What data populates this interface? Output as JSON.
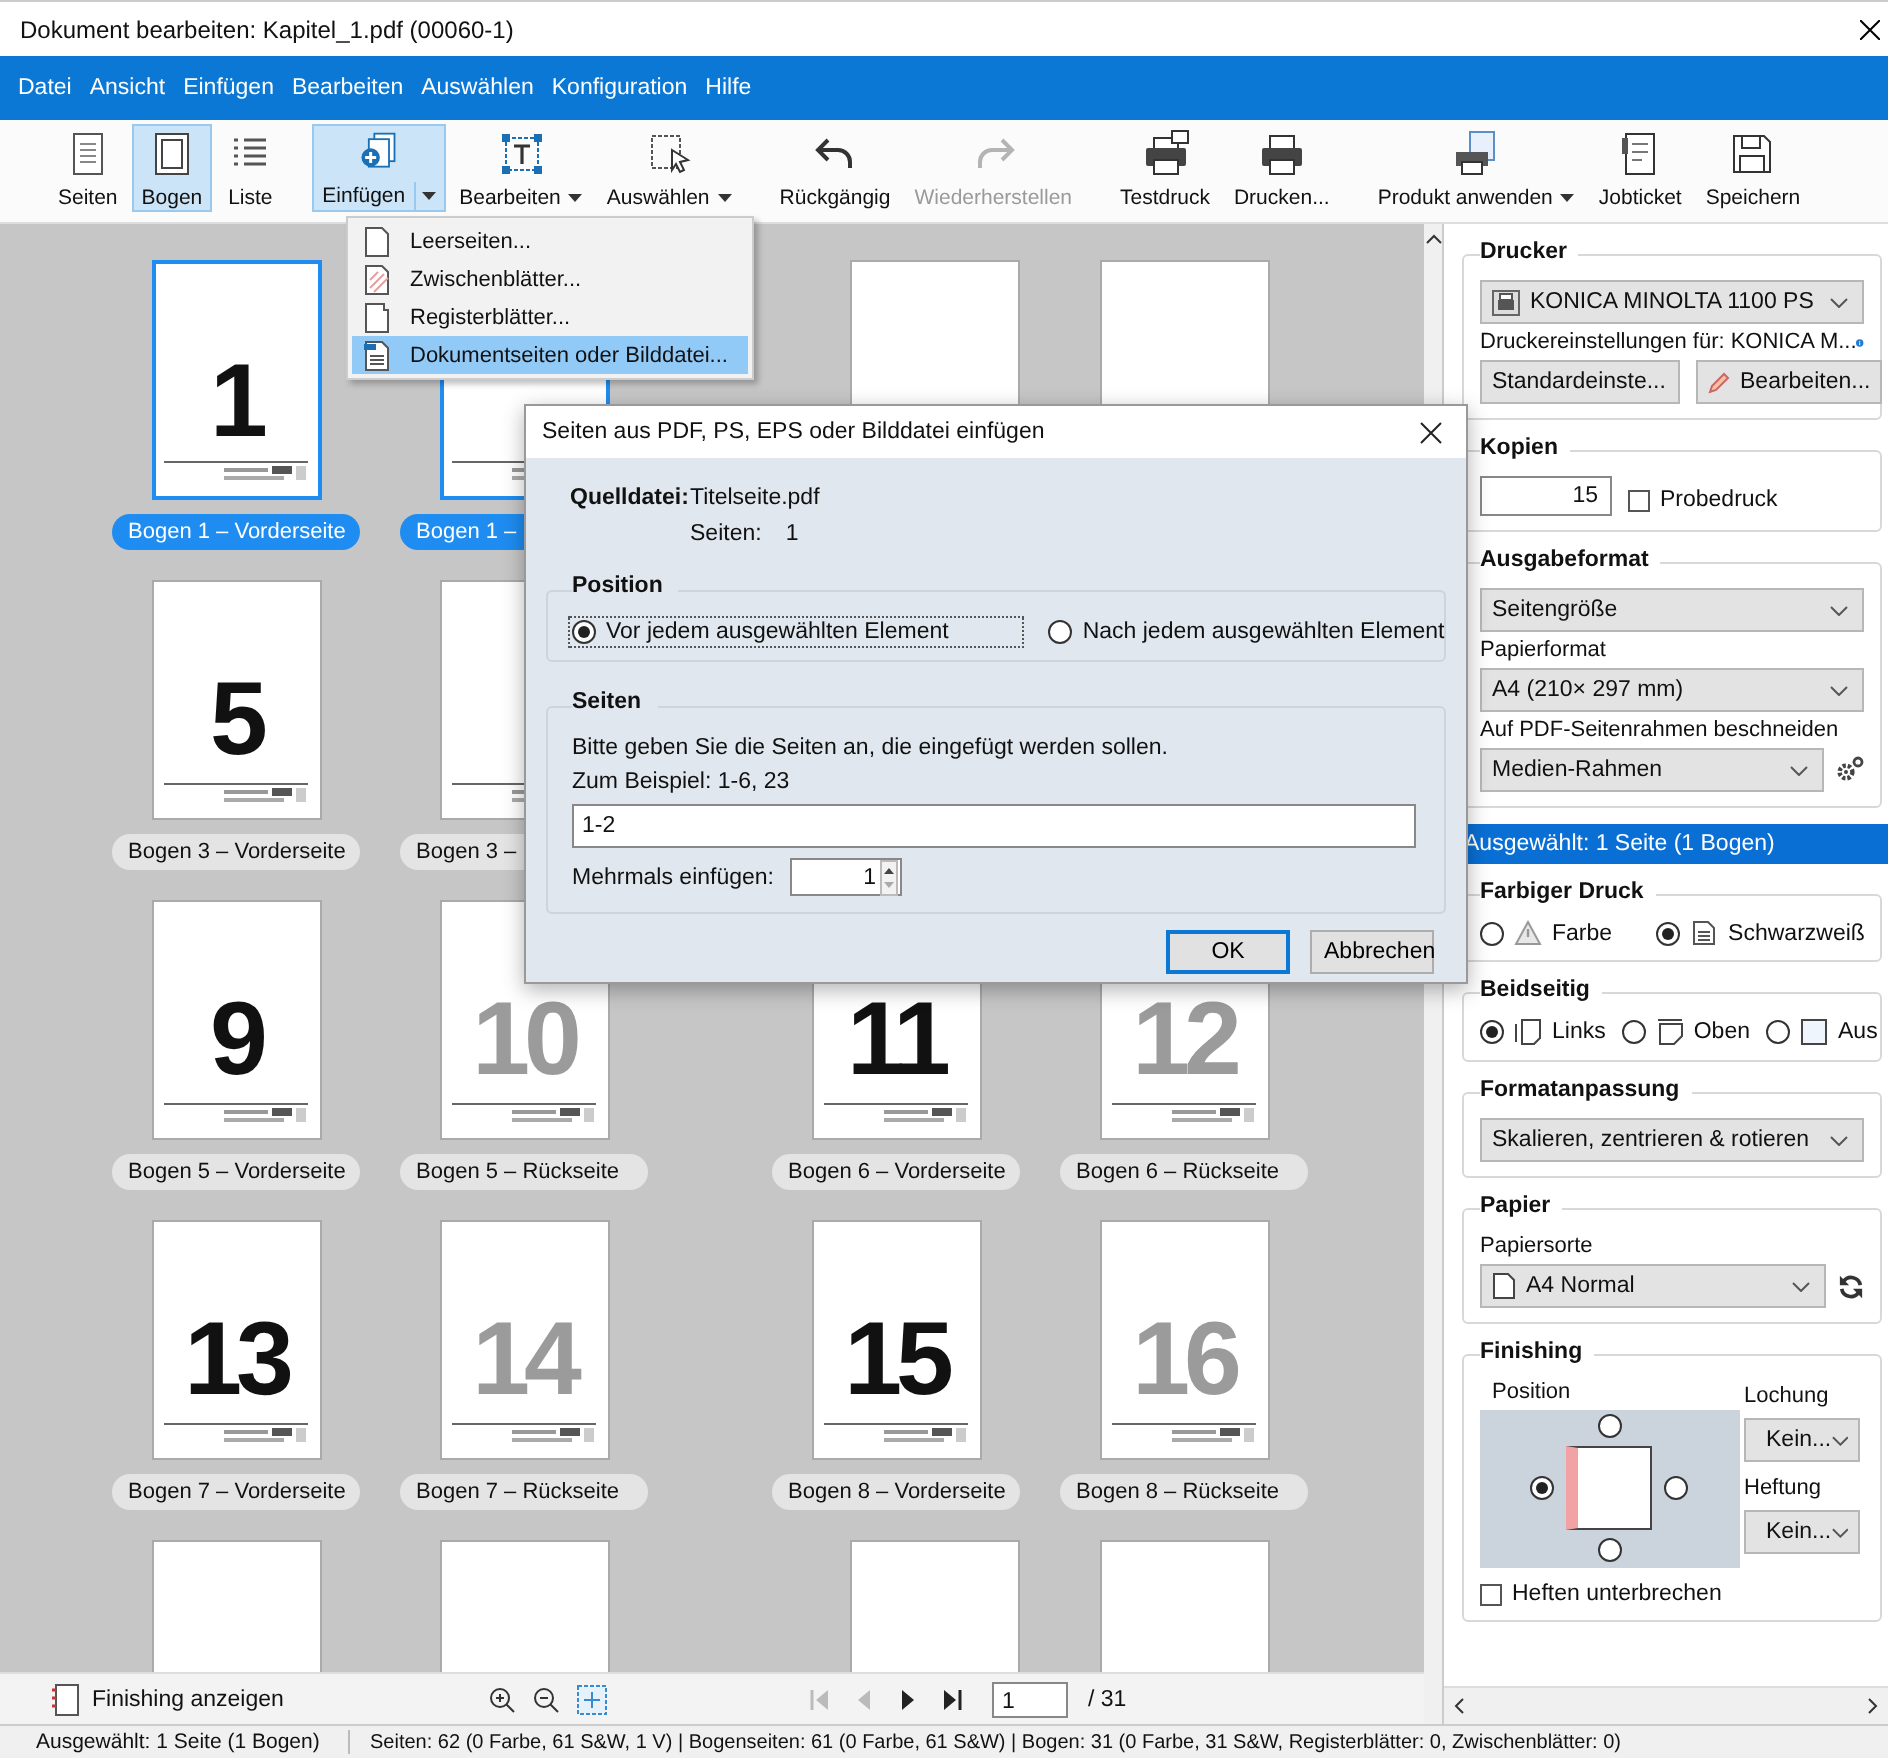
{
  "window": {
    "title": "Dokument bearbeiten: Kapitel_1.pdf (00060-1)"
  },
  "menu": [
    "Datei",
    "Ansicht",
    "Einfügen",
    "Bearbeiten",
    "Auswählen",
    "Konfiguration",
    "Hilfe"
  ],
  "toolbar": {
    "groups": [
      {
        "items": [
          {
            "label": "Seiten",
            "selected": false,
            "expanded": false,
            "disabled": false,
            "dropdown": false
          },
          {
            "label": "Bogen",
            "selected": true,
            "expanded": false,
            "disabled": false,
            "dropdown": false
          },
          {
            "label": "Liste",
            "selected": false,
            "expanded": false,
            "disabled": false,
            "dropdown": false
          }
        ]
      },
      {
        "items": [
          {
            "label": "Einfügen",
            "selected": false,
            "expanded": true,
            "disabled": false,
            "dropdown": true
          },
          {
            "label": "Bearbeiten",
            "selected": false,
            "expanded": false,
            "disabled": false,
            "dropdown": true
          },
          {
            "label": "Auswählen",
            "selected": false,
            "expanded": false,
            "disabled": false,
            "dropdown": true
          }
        ]
      },
      {
        "items": [
          {
            "label": "Rückgängig",
            "selected": false,
            "expanded": false,
            "disabled": false,
            "dropdown": false
          },
          {
            "label": "Wiederherstellen",
            "selected": false,
            "expanded": false,
            "disabled": true,
            "dropdown": false
          }
        ]
      },
      {
        "items": [
          {
            "label": "Testdruck",
            "selected": false,
            "expanded": false,
            "disabled": false,
            "dropdown": false
          },
          {
            "label": "Drucken...",
            "selected": false,
            "expanded": false,
            "disabled": false,
            "dropdown": false
          }
        ]
      },
      {
        "items": [
          {
            "label": "Produkt anwenden",
            "selected": false,
            "expanded": false,
            "disabled": false,
            "dropdown": true
          },
          {
            "label": "Jobticket",
            "selected": false,
            "expanded": false,
            "disabled": false,
            "dropdown": false
          },
          {
            "label": "Speichern",
            "selected": false,
            "expanded": false,
            "disabled": false,
            "dropdown": false
          }
        ]
      }
    ]
  },
  "insert_menu": [
    {
      "label": "Leerseiten...",
      "selected": false
    },
    {
      "label": "Zwischenblätter...",
      "selected": false
    },
    {
      "label": "Registerblätter...",
      "selected": false
    },
    {
      "label": "Dokumentseiten oder Bilddatei...",
      "selected": true
    }
  ],
  "thumbnails": {
    "rows": [
      [
        {
          "number": "1",
          "label": "Bogen 1 – Vorderseite",
          "kind": "front",
          "selected": true
        },
        {
          "label": "Bogen 1 –",
          "selected": true
        },
        {
          "selected": false
        },
        {
          "selected": false
        }
      ],
      [
        {
          "number": "5",
          "label": "Bogen 3 – Vorderseite",
          "kind": "front",
          "selected": false
        },
        {
          "label": "Bogen 3 –",
          "selected": false
        }
      ],
      [
        {
          "number": "9",
          "label": "Bogen 5 – Vorderseite",
          "kind": "front",
          "selected": false
        },
        {
          "number": "10",
          "label": "Bogen 5 – Rückseite",
          "kind": "back",
          "selected": false
        },
        {
          "number": "11",
          "label": "Bogen 6 – Vorderseite",
          "kind": "front",
          "selected": false
        },
        {
          "number": "12",
          "label": "Bogen 6 – Rückseite",
          "kind": "back",
          "selected": false
        }
      ],
      [
        {
          "number": "13",
          "label": "Bogen 7 – Vorderseite",
          "kind": "front",
          "selected": false
        },
        {
          "number": "14",
          "label": "Bogen 7 – Rückseite",
          "kind": "back",
          "selected": false
        },
        {
          "number": "15",
          "label": "Bogen 8 – Vorderseite",
          "kind": "front",
          "selected": false
        },
        {
          "number": "16",
          "label": "Bogen 8 – Rückseite",
          "kind": "back",
          "selected": false
        }
      ],
      [
        {
          "selected": false
        },
        {
          "selected": false
        },
        {
          "selected": false
        },
        {
          "selected": false
        }
      ]
    ]
  },
  "bottom_bar": {
    "finishing_toggle": "Finishing anzeigen",
    "nav": [
      {
        "kind": "first",
        "disabled": true
      },
      {
        "kind": "prev",
        "disabled": true
      },
      {
        "kind": "next",
        "disabled": false
      },
      {
        "kind": "last",
        "disabled": false
      }
    ],
    "page": "1",
    "page_total": "/ 31"
  },
  "panel": {
    "printer": {
      "title": "Drucker",
      "device": "KONICA MINOLTA 1100 PS",
      "settings_label": "Druckereinstellungen für: KONICA M...",
      "preset": "Standardeinste...",
      "edit_button": "Bearbeiten..."
    },
    "copies": {
      "title": "Kopien",
      "value": "15",
      "proof": {
        "label": "Probedruck",
        "checked": false
      }
    },
    "output": {
      "title": "Ausgabeformat",
      "size": "Seitengröße",
      "paper_label": "Papierformat",
      "paper": "A4 (210× 297 mm)",
      "crop_label": "Auf PDF-Seitenrahmen beschneiden",
      "crop": "Medien-Rahmen"
    },
    "selection": "Ausgewählt: 1 Seite (1 Bogen)",
    "color": {
      "title": "Farbiger Druck",
      "options": [
        {
          "label": "Farbe",
          "kind": "color",
          "selected": false
        },
        {
          "label": "Schwarzweiß",
          "kind": "gray",
          "selected": true
        }
      ]
    },
    "duplex": {
      "title": "Beidseitig",
      "options": [
        {
          "label": "Links",
          "kind": "left",
          "selected": true
        },
        {
          "label": "Oben",
          "kind": "top",
          "selected": false
        },
        {
          "label": "Aus",
          "kind": "off",
          "selected": false
        }
      ]
    },
    "fit": {
      "title": "Formatanpassung",
      "value": "Skalieren, zentrieren & rotieren"
    },
    "paper": {
      "title": "Papier",
      "type_label": "Papiersorte",
      "type": "A4 Normal"
    },
    "finishing": {
      "title": "Finishing",
      "position_label": "Position",
      "positions": [
        {
          "kind": "top",
          "selected": false
        },
        {
          "kind": "left",
          "selected": true
        },
        {
          "kind": "right",
          "selected": false
        },
        {
          "kind": "bottom",
          "selected": false
        }
      ],
      "punch_label": "Lochung",
      "punch": "Kein...",
      "staple_label": "Heftung",
      "staple": "Kein...",
      "interrupt": {
        "label": "Heften unterbrechen",
        "checked": false
      }
    }
  },
  "dialog": {
    "title": "Seiten aus PDF, PS, EPS oder Bilddatei einfügen",
    "source_label": "Quelldatei:",
    "source_file": "Titelseite.pdf",
    "pages_label": "Seiten:",
    "pages_value": "1",
    "position": {
      "title": "Position",
      "options": [
        {
          "label": "Vor jedem ausgewählten Element",
          "selected": true
        },
        {
          "label": "Nach jedem ausgewählten Element",
          "selected": false
        }
      ]
    },
    "pages": {
      "title": "Seiten",
      "hint": "Bitte geben Sie die Seiten an, die eingefügt werden sollen.",
      "example": "Zum Beispiel: 1-6, 23",
      "range": "1-2",
      "repeat_label": "Mehrmals einfügen:",
      "repeat_value": "1"
    },
    "buttons": [
      {
        "label": "OK",
        "default": true
      },
      {
        "label": "Abbrechen",
        "default": false
      }
    ]
  },
  "status_bar": [
    "Ausgewählt: 1 Seite (1 Bogen)",
    "Seiten: 62 (0 Farbe, 61 S&W, 1 V) | Bogenseiten: 61 (0 Farbe, 61 S&W) | Bogen: 31 (0 Farbe, 31 S&W, Registerblätter: 0, Zwischenblätter: 0)"
  ]
}
